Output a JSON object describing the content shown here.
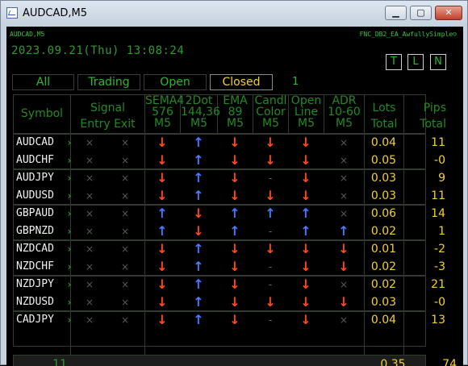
{
  "window": {
    "title": "AUDCAD,M5",
    "min_label": "▁",
    "max_label": "▢",
    "close_label": "✕"
  },
  "header": {
    "symbol_tf": "AUDCAD,M5",
    "ea_name": "FNC_DB2_EA_AwfullySimple☺",
    "datetime": "2023.09.21(Thu) 13:08:24"
  },
  "toggles": [
    "T",
    "L",
    "N"
  ],
  "tabs": [
    {
      "label": "All",
      "active": false
    },
    {
      "label": "Trading",
      "active": false
    },
    {
      "label": "Open",
      "active": false
    },
    {
      "label": "Closed",
      "active": true
    }
  ],
  "tab_count": "1",
  "columns": {
    "symbol": "Symbol",
    "signal": [
      "Signal",
      "Entry Exit"
    ],
    "sema4": [
      "SEMA4",
      "576",
      "M5"
    ],
    "dot2": [
      "2Dot",
      "144,36",
      "M5"
    ],
    "ema": [
      "EMA",
      "89",
      "M5"
    ],
    "candl": [
      "Candl",
      "Color",
      "M5"
    ],
    "openline": [
      "Open",
      "Line",
      "M5"
    ],
    "adr": [
      "ADR",
      "10-60",
      "M5"
    ],
    "lots": [
      "Lots",
      "Total"
    ],
    "pips": [
      "Pips",
      "Total"
    ]
  },
  "rows": [
    {
      "symbol": "AUDCAD",
      "entry": "x",
      "exit": "x",
      "sema4": "down",
      "dot2": "up",
      "ema": "down",
      "candl": "down",
      "openline": "down",
      "adr": "x",
      "lots": "0.04",
      "pips": "11"
    },
    {
      "symbol": "AUDCHF",
      "entry": "x",
      "exit": "x",
      "sema4": "down",
      "dot2": "up",
      "ema": "down",
      "candl": "down",
      "openline": "down",
      "adr": "x",
      "lots": "0.05",
      "pips": "-0"
    },
    {
      "symbol": "AUDJPY",
      "entry": "x",
      "exit": "x",
      "sema4": "down",
      "dot2": "up",
      "ema": "down",
      "candl": "-",
      "openline": "down",
      "adr": "x",
      "lots": "0.03",
      "pips": "9"
    },
    {
      "symbol": "AUDUSD",
      "entry": "x",
      "exit": "x",
      "sema4": "down",
      "dot2": "up",
      "ema": "down",
      "candl": "down",
      "openline": "down",
      "adr": "x",
      "lots": "0.03",
      "pips": "11"
    },
    {
      "symbol": "GBPAUD",
      "entry": "x",
      "exit": "x",
      "sema4": "up",
      "dot2": "down",
      "ema": "up",
      "candl": "up",
      "openline": "up",
      "adr": "x",
      "lots": "0.06",
      "pips": "14"
    },
    {
      "symbol": "GBPNZD",
      "entry": "x",
      "exit": "x",
      "sema4": "up",
      "dot2": "down",
      "ema": "up",
      "candl": "-",
      "openline": "up",
      "adr": "up",
      "lots": "0.02",
      "pips": "1"
    },
    {
      "symbol": "NZDCAD",
      "entry": "x",
      "exit": "x",
      "sema4": "down",
      "dot2": "up",
      "ema": "down",
      "candl": "down",
      "openline": "down",
      "adr": "down",
      "lots": "0.01",
      "pips": "-2"
    },
    {
      "symbol": "NZDCHF",
      "entry": "x",
      "exit": "x",
      "sema4": "down",
      "dot2": "up",
      "ema": "down",
      "candl": "-",
      "openline": "down",
      "adr": "down",
      "lots": "0.02",
      "pips": "-3"
    },
    {
      "symbol": "NZDJPY",
      "entry": "x",
      "exit": "x",
      "sema4": "down",
      "dot2": "up",
      "ema": "down",
      "candl": "-",
      "openline": "down",
      "adr": "x",
      "lots": "0.02",
      "pips": "21"
    },
    {
      "symbol": "NZDUSD",
      "entry": "x",
      "exit": "x",
      "sema4": "down",
      "dot2": "up",
      "ema": "down",
      "candl": "down",
      "openline": "down",
      "adr": "down",
      "lots": "0.03",
      "pips": "-0"
    },
    {
      "symbol": "CADJPY",
      "entry": "x",
      "exit": "x",
      "sema4": "down",
      "dot2": "up",
      "ema": "down",
      "candl": "-",
      "openline": "down",
      "adr": "x",
      "lots": "0.04",
      "pips": "13"
    }
  ],
  "totals": {
    "count": "11",
    "lots": "0.35",
    "pips": "74"
  },
  "colors": {
    "up": "#4a7aff",
    "down": "#ff4a1a",
    "text_green": "#2fb82f",
    "value_yellow": "#f0d232",
    "symbol_white": "#f2f2f2"
  }
}
